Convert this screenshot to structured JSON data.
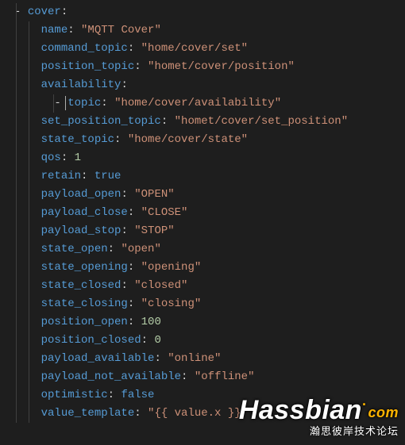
{
  "yaml": {
    "root_key": "cover",
    "entries": [
      {
        "key": "name",
        "value": "\"MQTT Cover\"",
        "type": "str"
      },
      {
        "key": "command_topic",
        "value": "\"home/cover/set\"",
        "type": "str"
      },
      {
        "key": "position_topic",
        "value": "\"homet/cover/position\"",
        "type": "str"
      },
      {
        "key": "availability",
        "value": "",
        "type": "none"
      },
      {
        "key": "topic",
        "value": "\"home/cover/availability\"",
        "type": "str",
        "nested": true,
        "dash": true
      },
      {
        "key": "set_position_topic",
        "value": "\"homet/cover/set_position\"",
        "type": "str"
      },
      {
        "key": "state_topic",
        "value": "\"home/cover/state\"",
        "type": "str"
      },
      {
        "key": "qos",
        "value": "1",
        "type": "num"
      },
      {
        "key": "retain",
        "value": "true",
        "type": "bool"
      },
      {
        "key": "payload_open",
        "value": "\"OPEN\"",
        "type": "str"
      },
      {
        "key": "payload_close",
        "value": "\"CLOSE\"",
        "type": "str"
      },
      {
        "key": "payload_stop",
        "value": "\"STOP\"",
        "type": "str"
      },
      {
        "key": "state_open",
        "value": "\"open\"",
        "type": "str"
      },
      {
        "key": "state_opening",
        "value": "\"opening\"",
        "type": "str"
      },
      {
        "key": "state_closed",
        "value": "\"closed\"",
        "type": "str"
      },
      {
        "key": "state_closing",
        "value": "\"closing\"",
        "type": "str"
      },
      {
        "key": "position_open",
        "value": "100",
        "type": "num"
      },
      {
        "key": "position_closed",
        "value": "0",
        "type": "num"
      },
      {
        "key": "payload_available",
        "value": "\"online\"",
        "type": "str"
      },
      {
        "key": "payload_not_available",
        "value": "\"offline\"",
        "type": "str"
      },
      {
        "key": "optimistic",
        "value": "false",
        "type": "bool"
      },
      {
        "key": "value_template",
        "value": "\"{{ value.x }}\"",
        "type": "str"
      }
    ]
  },
  "watermark": {
    "brand": "Hassbian",
    "tld": "com",
    "cn": "瀚思彼岸技术论坛"
  }
}
